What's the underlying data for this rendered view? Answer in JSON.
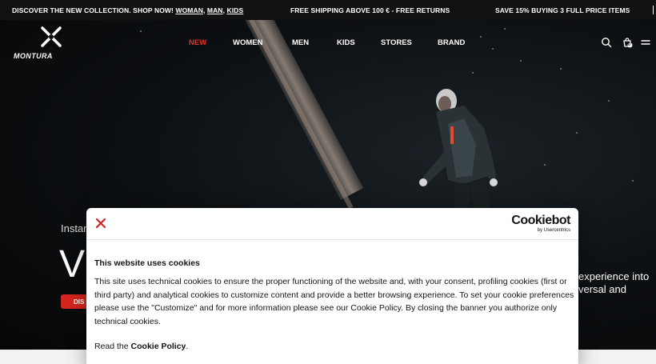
{
  "topbar": {
    "promo1_text": "DISCOVER THE NEW COLLECTION. SHOP NOW! ",
    "promo1_links": [
      "WOMAN",
      "MAN",
      "KIDS"
    ],
    "promo2": "FREE SHIPPING ABOVE 100 € - FREE RETURNS",
    "promo3": "SAVE 15% BUYING 3 FULL PRICE ITEMS"
  },
  "header": {
    "logo_text": "MONTURA",
    "nav": [
      "NEW",
      "WOMEN",
      "MEN",
      "KIDS",
      "STORES",
      "BRAND"
    ],
    "cart_count": "0",
    "accent_color": "#e2302a"
  },
  "hero": {
    "kicker": "Instan",
    "title": "V",
    "cta": "DIS",
    "right_text_line1": "experience into",
    "right_text_line2": "versal and"
  },
  "cookie": {
    "brand": "Cookiebot",
    "brand_sub": "by Usercentrics",
    "title": "This website uses cookies",
    "body": "This site uses technical cookies to ensure the proper functioning of the website and, with your consent, profiling cookies (first or third party) and analytical cookies to customize content and provide a better browsing experience. To set your cookie preferences please use the \"Customize\" and for more information please see our Cookie Policy. By closing the banner you authorize only technical cookies.",
    "read_prefix": "Read the ",
    "read_link": "Cookie Policy",
    "read_suffix": "."
  }
}
